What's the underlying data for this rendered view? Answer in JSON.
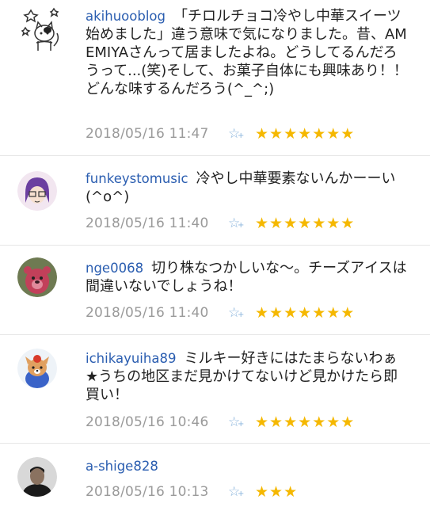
{
  "colors": {
    "username": "#2a5db0",
    "timestamp": "#9a9a9a",
    "star": "#f5b800",
    "star_add": "#8ab4dc"
  },
  "comments": [
    {
      "username": "akihuooblog",
      "text": "「チロルチョコ冷やし中華スイーツ始めました」違う意味で気になりました。昔、AMEMIYAさんって居ましたよね。どうしてるんだろうって...(笑)そして、お菓子自体にも興味あり！！どんな味するんだろう(^_^;)",
      "timestamp": "2018/05/16 11:47",
      "star_add_icon": "add-star-icon",
      "stars": 7
    },
    {
      "username": "funkeystomusic",
      "text": "冷やし中華要素ないんかーーい(^o^)",
      "timestamp": "2018/05/16 11:40",
      "star_add_icon": "add-star-icon",
      "stars": 7
    },
    {
      "username": "nge0068",
      "text": "切り株なつかしいな〜。チーズアイスは間違いないでしょうね！",
      "timestamp": "2018/05/16 11:40",
      "star_add_icon": "add-star-icon",
      "stars": 7
    },
    {
      "username": "ichikayuiha89",
      "text": "ミルキー好きにはたまらないわぁ★うちの地区まだ見かけてないけど見かけたら即買い！",
      "timestamp": "2018/05/16 10:46",
      "star_add_icon": "add-star-icon",
      "stars": 7
    },
    {
      "username": "a-shige828",
      "text": "",
      "timestamp": "2018/05/16 10:13",
      "star_add_icon": "add-star-icon",
      "stars": 3
    }
  ]
}
